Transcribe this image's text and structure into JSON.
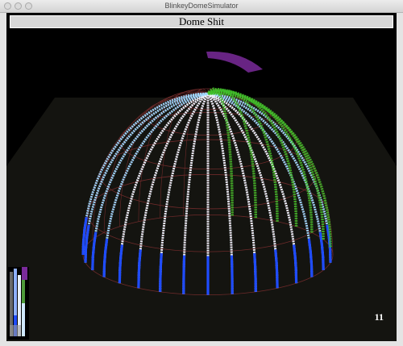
{
  "window": {
    "title": "BlinkeyDomeSimulator"
  },
  "header": {
    "title": "Dome Shit"
  },
  "status": {
    "frame_number": "11"
  },
  "colors": {
    "background": "#000000",
    "floor": "#141410",
    "wire": "#6e2a2a",
    "strip_blue": "#1f4cff",
    "strip_white": "#eef4ff",
    "strip_green": "#3fbf2a",
    "strip_purple": "#7a2a9a",
    "title_bg": "#d8d8d8"
  },
  "icons": [
    "close-icon",
    "minimize-icon",
    "zoom-icon"
  ]
}
